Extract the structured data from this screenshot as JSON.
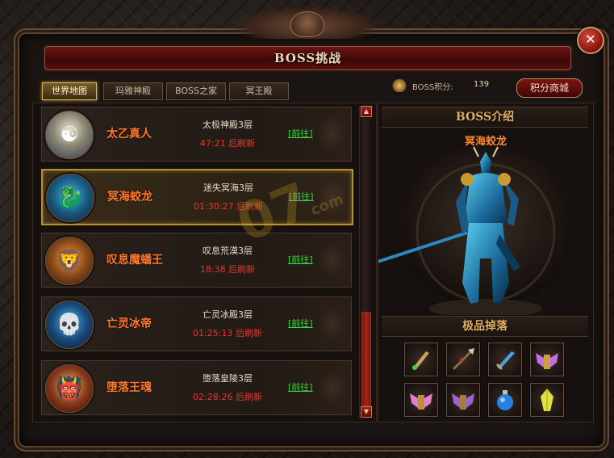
{
  "window": {
    "title": "BOSS挑战",
    "close_icon": "close-icon"
  },
  "tabs": [
    {
      "label": "世界地图",
      "active": true
    },
    {
      "label": "玛雅神殿",
      "active": false
    },
    {
      "label": "BOSS之家",
      "active": false
    },
    {
      "label": "冥王殿",
      "active": false
    }
  ],
  "score": {
    "icon": "wings-badge-icon",
    "label": "BOSS积分:",
    "value": "139",
    "shop_label": "积分商城"
  },
  "boss_list": [
    {
      "name": "太乙真人",
      "location": "太极神殿3层",
      "timer": "47:21",
      "refresh_label": "后刷新",
      "goto_label": "[前往]",
      "avatar_icon": "sage-avatar-icon",
      "selected": false
    },
    {
      "name": "冥海蛟龙",
      "location": "迷失冥海3层",
      "timer": "01:30:27",
      "refresh_label": "后刷新",
      "goto_label": "[前往]",
      "avatar_icon": "sea-dragon-avatar-icon",
      "selected": true
    },
    {
      "name": "叹息魔蟠王",
      "location": "叹息荒漠3层",
      "timer": "18:38",
      "refresh_label": "后刷新",
      "goto_label": "[前往]",
      "avatar_icon": "beast-king-avatar-icon",
      "selected": false
    },
    {
      "name": "亡灵冰帝",
      "location": "亡灵冰殿3层",
      "timer": "01:25:13",
      "refresh_label": "后刷新",
      "goto_label": "[前往]",
      "avatar_icon": "ice-emperor-avatar-icon",
      "selected": false
    },
    {
      "name": "堕落王魂",
      "location": "堕落皇陵3层",
      "timer": "02:28:26",
      "refresh_label": "后刷新",
      "goto_label": "[前往]",
      "avatar_icon": "fallen-king-avatar-icon",
      "selected": false
    }
  ],
  "boss_intro": {
    "heading": "BOSS介绍",
    "name": "冥海蛟龙",
    "figure_icon": "sea-dragon-figure-icon"
  },
  "loot": {
    "heading": "极品掉落",
    "items": [
      {
        "icon": "green-sword-icon"
      },
      {
        "icon": "spear-icon"
      },
      {
        "icon": "blue-blade-icon"
      },
      {
        "icon": "winged-armor-purple-icon"
      },
      {
        "icon": "winged-armor-pink-icon"
      },
      {
        "icon": "winged-armor-violet-icon"
      },
      {
        "icon": "blue-potion-icon"
      },
      {
        "icon": "yellow-crystal-icon"
      }
    ]
  },
  "watermark": {
    "text": "07",
    "sub": "com"
  },
  "colors": {
    "boss_name": "#ff7a2a",
    "timer": "#e23a2a",
    "goto_link": "#3cd048",
    "header_gold": "#e0b060",
    "title_red": "#6e1414"
  }
}
